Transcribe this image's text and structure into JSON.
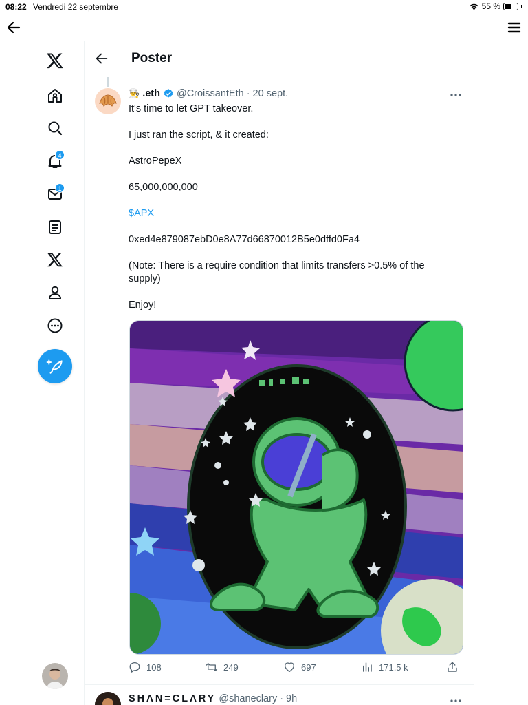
{
  "status_bar": {
    "time": "08:22",
    "date": "Vendredi 22 septembre",
    "battery": "55 %",
    "battery_level": 0.55
  },
  "app_bar": {
    "back_icon": "arrow-left-icon",
    "menu_icon": "menu-icon"
  },
  "nav": {
    "items": [
      {
        "name": "x-logo-icon"
      },
      {
        "name": "home-icon"
      },
      {
        "name": "search-icon"
      },
      {
        "name": "notifications-icon",
        "badge": "4"
      },
      {
        "name": "messages-icon",
        "badge": "1"
      },
      {
        "name": "lists-icon"
      },
      {
        "name": "x-premium-icon"
      },
      {
        "name": "profile-icon"
      },
      {
        "name": "more-icon"
      }
    ],
    "compose_icon": "feather-plus-icon",
    "accent": "#1d9bf0"
  },
  "header": {
    "title": "Poster"
  },
  "tweet": {
    "author_name": ".eth",
    "author_emoji": "👨‍🍳",
    "verified": true,
    "handle": "@CroissantEth",
    "separator": "·",
    "date": "20 sept.",
    "lines": {
      "l1": "It's time to let GPT takeover.",
      "l2": "I just ran the script, & it created:",
      "l3": "AstroPepeX",
      "l4": "65,000,000,000",
      "cashtag": "$APX",
      "l5": "0xed4e879087ebD0e8A77d66870012B5e0dffd0Fa4",
      "l6": "(Note: There is a require condition that limits transfers >0.5% of the supply)",
      "l7": "Enjoy!"
    },
    "media_alt": "astronaut-frog-illustration",
    "stats": {
      "replies": "108",
      "reposts": "249",
      "likes": "697",
      "views": "171,5 k"
    }
  },
  "next_tweet": {
    "author_name": "SHANECLARY",
    "author_display": "SHΛN=CLΛRY",
    "handle": "@shaneclary",
    "separator": "·",
    "time": "9h"
  }
}
